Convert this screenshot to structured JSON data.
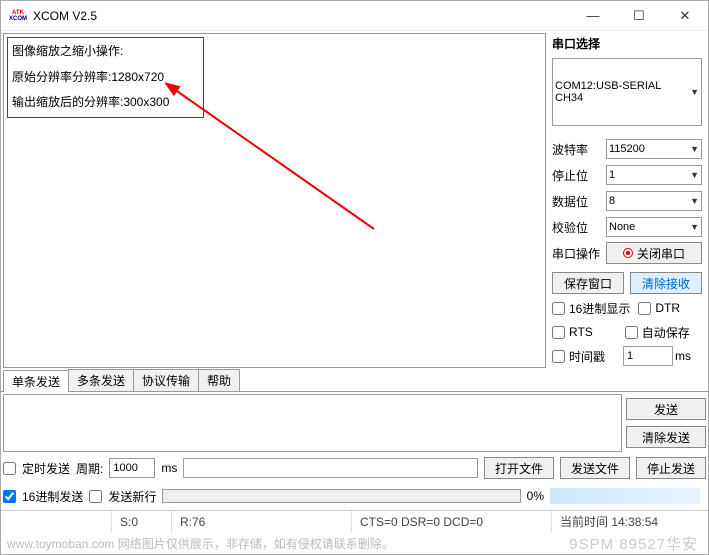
{
  "window": {
    "title": "XCOM V2.5"
  },
  "output": {
    "line1": "图像缩放之缩小操作:",
    "line2": "原始分辨率分辨率:1280x720",
    "line3": "输出缩放后的分辨率:300x300"
  },
  "serial": {
    "section_title": "串口选择",
    "port": "COM12:USB-SERIAL CH34",
    "baud_label": "波特率",
    "baud_value": "115200",
    "stop_label": "停止位",
    "stop_value": "1",
    "data_label": "数据位",
    "data_value": "8",
    "parity_label": "校验位",
    "parity_value": "None",
    "op_label": "串口操作",
    "op_button": "关闭串口",
    "save_window": "保存窗口",
    "clear_recv": "清除接收",
    "hex_display": "16进制显示",
    "dtr": "DTR",
    "rts": "RTS",
    "auto_save": "自动保存",
    "timestamp": "时间戳",
    "timestamp_value": "1",
    "timestamp_unit": "ms"
  },
  "tabs": {
    "single": "单条发送",
    "multi": "多条发送",
    "protocol": "协议传输",
    "help": "帮助"
  },
  "send": {
    "send_btn": "发送",
    "clear_send": "清除发送",
    "timed_send": "定时发送",
    "period_label": "周期:",
    "period_value": "1000",
    "period_unit": "ms",
    "open_file": "打开文件",
    "send_file": "发送文件",
    "stop_send": "停止发送",
    "hex_send": "16进制发送",
    "send_newline": "发送新行",
    "progress_pct": "0%"
  },
  "status": {
    "s": "S:0",
    "r": "R:76",
    "signals": "CTS=0 DSR=0 DCD=0",
    "time_label": "当前时间 14:38:54"
  },
  "watermark": {
    "left": "www.toymoban.com  网络图片仅供展示，非存储，如有侵权请联系删除。",
    "right": "9SPM 89527华安"
  }
}
